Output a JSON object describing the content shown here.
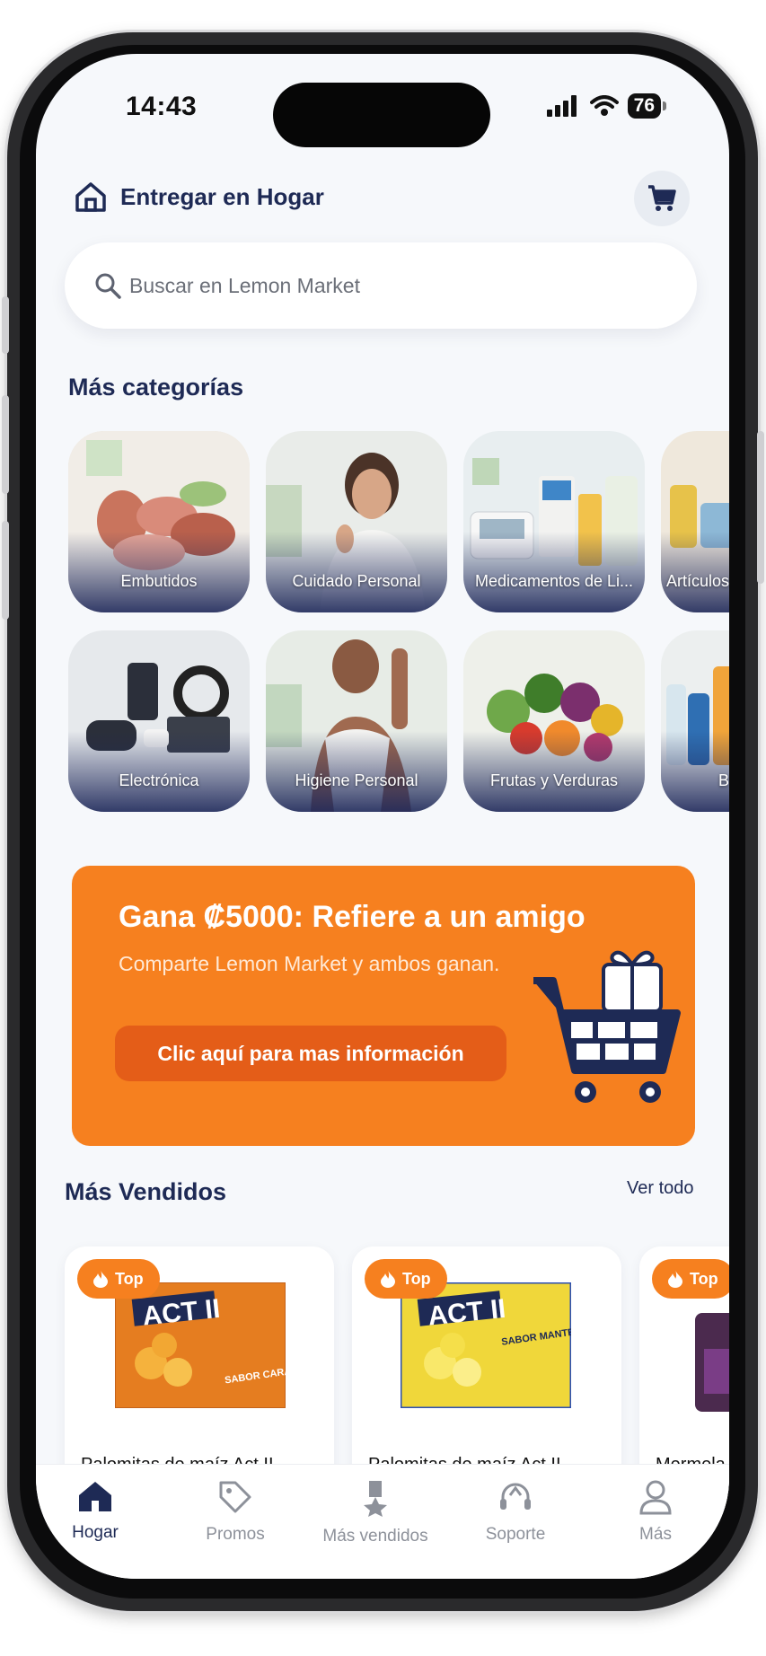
{
  "status_bar": {
    "time": "14:43",
    "battery": "76"
  },
  "header": {
    "title": "Entregar en Hogar"
  },
  "search": {
    "placeholder": "Buscar en Lemon Market"
  },
  "categories": {
    "title": "Más categorías",
    "items": [
      {
        "label": "Embutidos"
      },
      {
        "label": "Cuidado Personal"
      },
      {
        "label": "Medicamentos de Li..."
      },
      {
        "label": "Artículos"
      },
      {
        "label": "Electrónica"
      },
      {
        "label": "Higiene Personal"
      },
      {
        "label": "Frutas y Verduras"
      },
      {
        "label": "B"
      }
    ]
  },
  "promo": {
    "title": "Gana ₡5000: Refiere a un amigo",
    "subtitle": "Comparte Lemon Market y ambos ganan.",
    "button": "Clic aquí para mas información"
  },
  "best_sellers": {
    "title": "Más Vendidos",
    "see_all": "Ver todo",
    "badge": "Top",
    "products": [
      {
        "name": "Palomitas de maíz Act II",
        "brand": "ACT II",
        "flavor": "SABOR CARAMELO"
      },
      {
        "name": "Palomitas de maíz Act II",
        "brand": "ACT II",
        "flavor": "SABOR MANTEQUILLA"
      },
      {
        "name": "Mermela"
      }
    ]
  },
  "tabbar": {
    "items": [
      {
        "label": "Hogar"
      },
      {
        "label": "Promos"
      },
      {
        "label": "Más vendidos"
      },
      {
        "label": "Soporte"
      },
      {
        "label": "Más"
      }
    ]
  },
  "colors": {
    "accent": "#f6801f",
    "navy": "#1e2a55",
    "background": "#f6f8fb"
  }
}
